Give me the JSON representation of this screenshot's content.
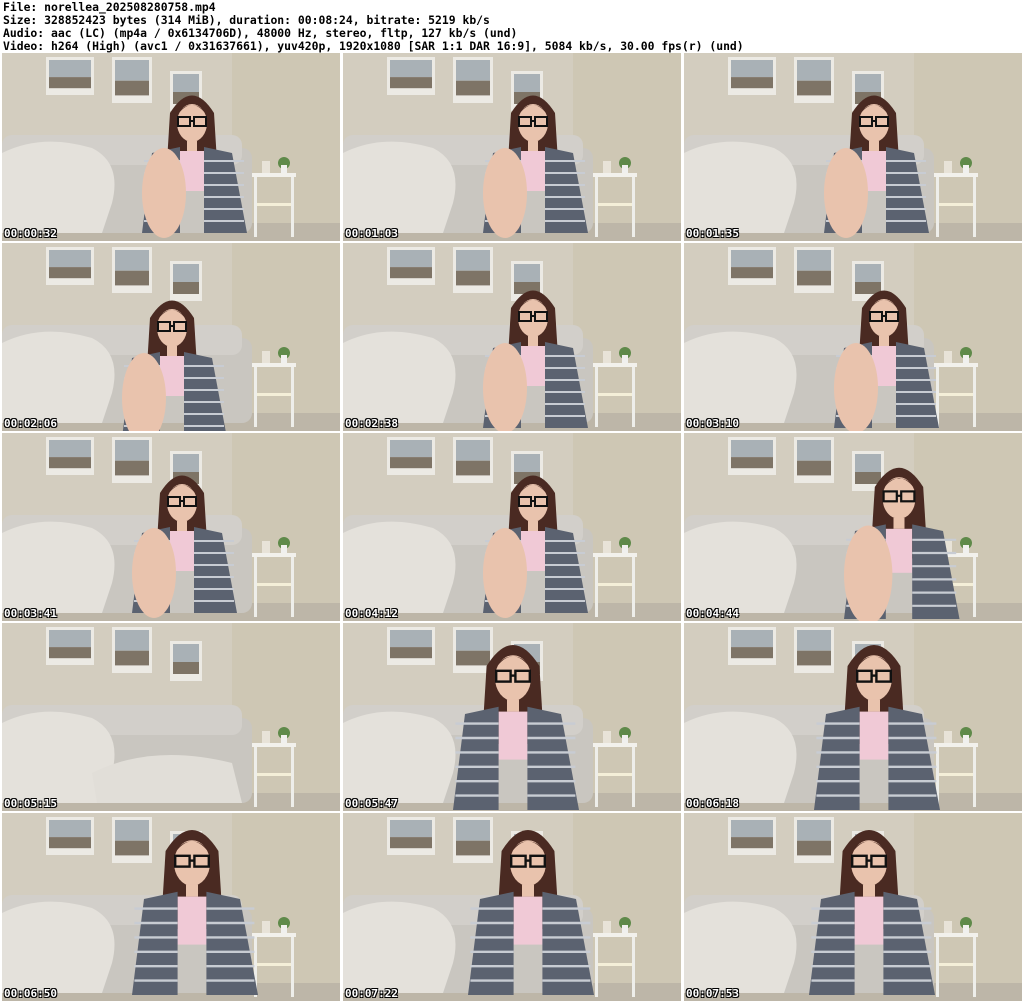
{
  "header": {
    "file": "File: norellea_202508280758.mp4",
    "size": "Size: 328852423 bytes (314 MiB), duration: 00:08:24, bitrate: 5219 kb/s",
    "audio": "Audio: aac (LC) (mp4a / 0x6134706D), 48000 Hz, stereo, fltp, 127 kb/s (und)",
    "video": "Video: h264 (High) (avc1 / 0x31637661), yuv420p, 1920x1080 [SAR 1:1 DAR 16:9], 5084 kb/s, 30.00 fps(r) (und)"
  },
  "thumbnails": [
    {
      "timestamp": "00:00:32",
      "subject": "person"
    },
    {
      "timestamp": "00:01:03",
      "subject": "person"
    },
    {
      "timestamp": "00:01:35",
      "subject": "person"
    },
    {
      "timestamp": "00:02:06",
      "subject": "person"
    },
    {
      "timestamp": "00:02:38",
      "subject": "person"
    },
    {
      "timestamp": "00:03:10",
      "subject": "person"
    },
    {
      "timestamp": "00:03:41",
      "subject": "person"
    },
    {
      "timestamp": "00:04:12",
      "subject": "person"
    },
    {
      "timestamp": "00:04:44",
      "subject": "person"
    },
    {
      "timestamp": "00:05:15",
      "subject": "empty-room"
    },
    {
      "timestamp": "00:05:47",
      "subject": "person"
    },
    {
      "timestamp": "00:06:18",
      "subject": "person"
    },
    {
      "timestamp": "00:06:50",
      "subject": "person"
    },
    {
      "timestamp": "00:07:22",
      "subject": "person"
    },
    {
      "timestamp": "00:07:53",
      "subject": "person"
    }
  ],
  "colors": {
    "wall": "#d3cdbf",
    "sofa": "#c9c6c0",
    "blanket": "#e4e1db",
    "shirt_dark": "#5b6270",
    "shirt_light": "#c8ccd3",
    "hair": "#4a2a22",
    "skin": "#e9c3ad",
    "top": "#f0c9d6"
  }
}
